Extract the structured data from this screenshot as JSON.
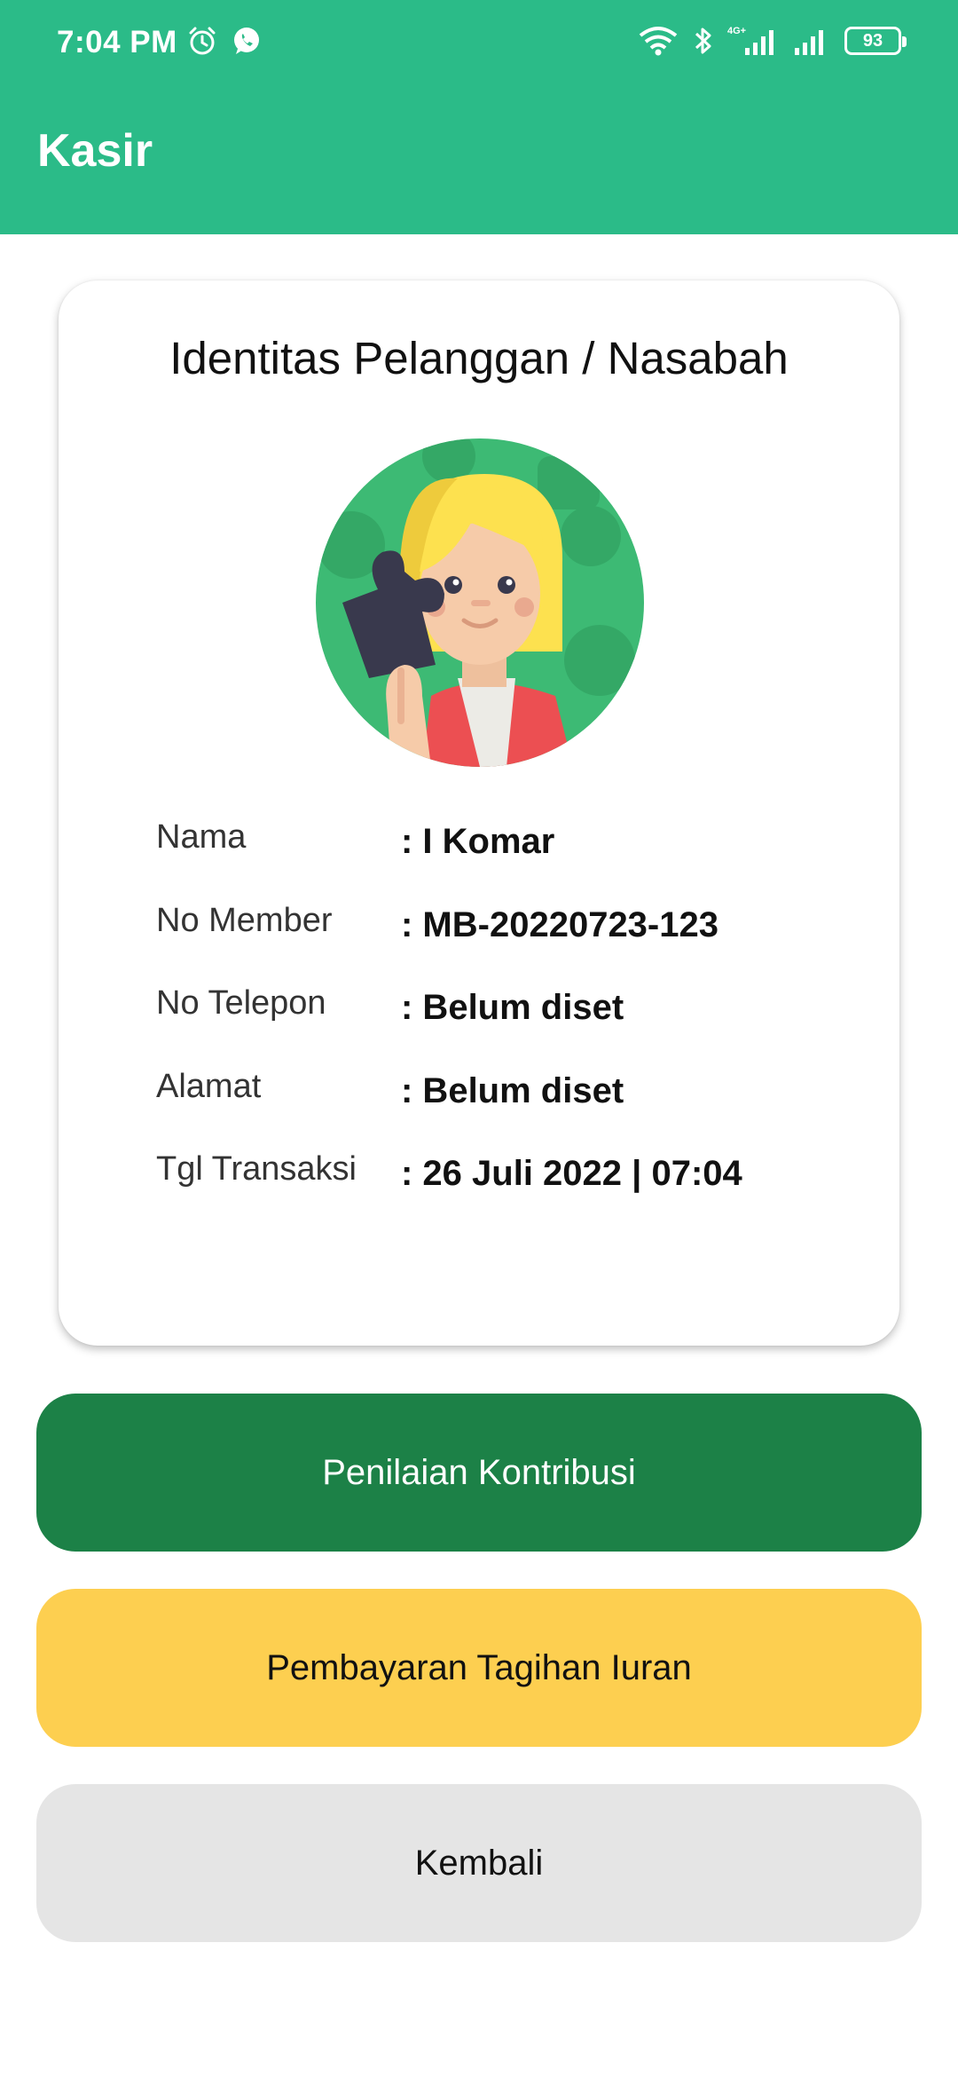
{
  "status_bar": {
    "time": "7:04 PM",
    "left_icons": [
      "alarm-icon",
      "whatsapp-icon"
    ],
    "right_icons": [
      "wifi-icon",
      "bluetooth-icon",
      "signal-4g-icon",
      "signal-icon"
    ],
    "battery": "93"
  },
  "app_bar": {
    "title": "Kasir",
    "color": "#2bbb88"
  },
  "card": {
    "title": "Identitas Pelanggan / Nasabah",
    "avatar_icon": "user-avatar-icon",
    "rows": [
      {
        "label": "Nama",
        "value": ": I Komar"
      },
      {
        "label": "No Member",
        "value": ": MB-20220723-123"
      },
      {
        "label": "No Telepon",
        "value": ": Belum diset"
      },
      {
        "label": "Alamat",
        "value": ": Belum diset"
      },
      {
        "label": "Tgl Transaksi",
        "value": ": 26 Juli 2022 | 07:04"
      }
    ]
  },
  "buttons": {
    "penilaian": {
      "label": "Penilaian Kontribusi",
      "color": "#1c8147"
    },
    "pembayaran": {
      "label": "Pembayaran Tagihan Iuran",
      "color": "#fdcf50"
    },
    "kembali": {
      "label": "Kembali",
      "color": "#e5e5e5"
    }
  }
}
